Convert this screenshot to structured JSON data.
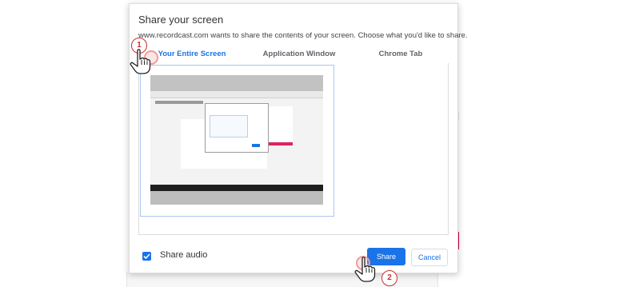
{
  "dialog": {
    "title": "Share your screen",
    "subtitle": "www.recordcast.com wants to share the contents of your screen. Choose what you'd like to share.",
    "tabs": [
      {
        "label": "Your Entire Screen",
        "active": true
      },
      {
        "label": "Application Window",
        "active": false
      },
      {
        "label": "Chrome Tab",
        "active": false
      }
    ],
    "share_audio": {
      "label": "Share audio",
      "checked": true
    },
    "buttons": {
      "share": "Share",
      "cancel": "Cancel"
    }
  },
  "annotations": {
    "step1": "1",
    "step2": "2"
  },
  "colors": {
    "accent": "#1a73e8",
    "annotation_red": "#c9302c"
  },
  "icons": [
    "checkmark-icon",
    "pointer-hand-icon"
  ]
}
